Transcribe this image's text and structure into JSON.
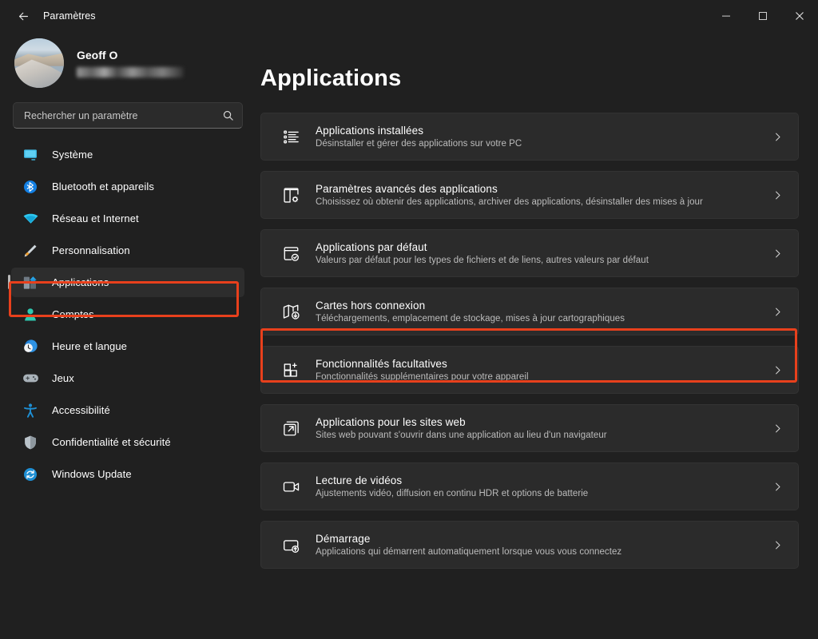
{
  "window": {
    "title": "Paramètres",
    "back_label": "←",
    "minimize_label": "−",
    "maximize_label": "□",
    "close_label": "✕"
  },
  "account": {
    "name": "Geoff O",
    "email_redacted": ""
  },
  "search": {
    "placeholder": "Rechercher un paramètre",
    "value": "",
    "icon": "search-icon"
  },
  "sidebar": {
    "items": [
      {
        "label": "Système",
        "icon": "monitor-icon",
        "selected": false
      },
      {
        "label": "Bluetooth et appareils",
        "icon": "bluetooth-icon",
        "selected": false
      },
      {
        "label": "Réseau et Internet",
        "icon": "wifi-icon",
        "selected": false
      },
      {
        "label": "Personnalisation",
        "icon": "paintbrush-icon",
        "selected": false
      },
      {
        "label": "Applications",
        "icon": "apps-icon",
        "selected": true
      },
      {
        "label": "Comptes",
        "icon": "person-icon",
        "selected": false
      },
      {
        "label": "Heure et langue",
        "icon": "clock-globe-icon",
        "selected": false
      },
      {
        "label": "Jeux",
        "icon": "gamepad-icon",
        "selected": false
      },
      {
        "label": "Accessibilité",
        "icon": "accessibility-icon",
        "selected": false
      },
      {
        "label": "Confidentialité et sécurité",
        "icon": "shield-icon",
        "selected": false
      },
      {
        "label": "Windows Update",
        "icon": "update-icon",
        "selected": false
      }
    ]
  },
  "main": {
    "title": "Applications",
    "cards": [
      {
        "title": "Applications installées",
        "subtitle": "Désinstaller et gérer des applications sur votre PC",
        "icon": "app-list-icon",
        "highlighted": false
      },
      {
        "title": "Paramètres avancés des applications",
        "subtitle": "Choisissez où obtenir des applications, archiver des applications, désinstaller des mises à jour",
        "icon": "app-settings-icon",
        "highlighted": false
      },
      {
        "title": "Applications par défaut",
        "subtitle": "Valeurs par défaut pour les types de fichiers et de liens, autres valeurs par défaut",
        "icon": "app-default-check-icon",
        "highlighted": false
      },
      {
        "title": "Cartes hors connexion",
        "subtitle": "Téléchargements, emplacement de stockage, mises à jour cartographiques",
        "icon": "map-download-icon",
        "highlighted": false
      },
      {
        "title": "Fonctionnalités facultatives",
        "subtitle": "Fonctionnalités supplémentaires pour votre appareil",
        "icon": "grid-plus-icon",
        "highlighted": true
      },
      {
        "title": "Applications pour les sites web",
        "subtitle": "Sites web pouvant s'ouvrir dans une application au lieu d'un navigateur",
        "icon": "external-link-icon",
        "highlighted": false
      },
      {
        "title": "Lecture de vidéos",
        "subtitle": "Ajustements vidéo, diffusion en continu HDR et options de batterie",
        "icon": "video-camera-icon",
        "highlighted": false
      },
      {
        "title": "Démarrage",
        "subtitle": "Applications qui démarrent automatiquement lorsque vous vous connectez",
        "icon": "startup-icon",
        "highlighted": false
      }
    ],
    "chevron_glyph": "›"
  },
  "annotations": {
    "color": "#e8401c",
    "targets": [
      "sidebar-item-applications",
      "card-fonctionnalites-facultatives"
    ]
  }
}
